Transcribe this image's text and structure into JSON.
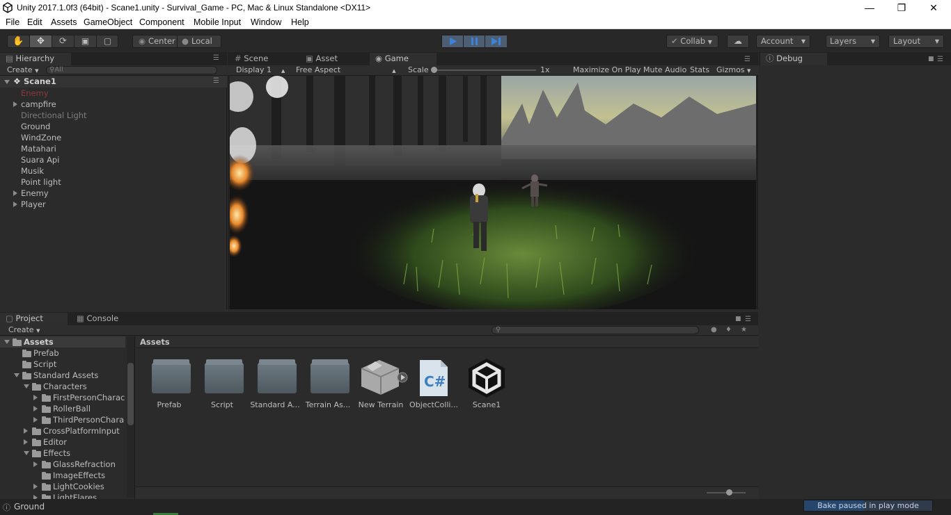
{
  "window": {
    "title": "Unity 2017.1.0f3 (64bit) - Scane1.unity - Survival_Game - PC, Mac & Linux Standalone <DX11>"
  },
  "menu": [
    "File",
    "Edit",
    "Assets",
    "GameObject",
    "Component",
    "Mobile Input",
    "Window",
    "Help"
  ],
  "toolbar": {
    "pivot": "Center",
    "space": "Local",
    "collab": "Collab",
    "account": "Account",
    "layers": "Layers",
    "layout": "Layout",
    "accent": "#3d82d6"
  },
  "hierarchy": {
    "tab": "Hierarchy",
    "create": "Create",
    "search_placeholder": "All",
    "scene": "Scane1",
    "items": [
      {
        "label": "Enemy",
        "expandable": false,
        "state": "missing"
      },
      {
        "label": "campfire",
        "expandable": true,
        "state": "normal"
      },
      {
        "label": "Directional Light",
        "expandable": false,
        "state": "disabled"
      },
      {
        "label": "Ground",
        "expandable": false,
        "state": "normal"
      },
      {
        "label": "WindZone",
        "expandable": false,
        "state": "normal"
      },
      {
        "label": "Matahari",
        "expandable": false,
        "state": "normal"
      },
      {
        "label": "Suara Api",
        "expandable": false,
        "state": "normal"
      },
      {
        "label": "Musik",
        "expandable": false,
        "state": "normal"
      },
      {
        "label": "Point light",
        "expandable": false,
        "state": "normal"
      },
      {
        "label": "Enemy",
        "expandable": true,
        "state": "normal"
      },
      {
        "label": "Player",
        "expandable": true,
        "state": "normal"
      }
    ]
  },
  "center_tabs": {
    "scene": "Scene",
    "asset_store": "Asset Store",
    "game": "Game"
  },
  "game_bar": {
    "display": "Display 1",
    "aspect": "Free Aspect",
    "scale_label": "Scale",
    "scale_value": "1x",
    "maximize": "Maximize On Play",
    "mute": "Mute Audio",
    "stats": "Stats",
    "gizmos": "Gizmos"
  },
  "debug": {
    "tab": "Debug"
  },
  "project": {
    "tab_project": "Project",
    "tab_console": "Console",
    "create": "Create",
    "breadcrumb": "Assets",
    "tree": [
      {
        "label": "Assets",
        "depth": 0,
        "arrow": "down",
        "bold": true
      },
      {
        "label": "Prefab",
        "depth": 1,
        "arrow": "none",
        "bold": false
      },
      {
        "label": "Script",
        "depth": 1,
        "arrow": "none",
        "bold": false
      },
      {
        "label": "Standard Assets",
        "depth": 1,
        "arrow": "down",
        "bold": false
      },
      {
        "label": "Characters",
        "depth": 2,
        "arrow": "down",
        "bold": false
      },
      {
        "label": "FirstPersonCharac",
        "depth": 3,
        "arrow": "right",
        "bold": false
      },
      {
        "label": "RollerBall",
        "depth": 3,
        "arrow": "right",
        "bold": false
      },
      {
        "label": "ThirdPersonChara",
        "depth": 3,
        "arrow": "right",
        "bold": false
      },
      {
        "label": "CrossPlatformInput",
        "depth": 2,
        "arrow": "right",
        "bold": false
      },
      {
        "label": "Editor",
        "depth": 2,
        "arrow": "right",
        "bold": false
      },
      {
        "label": "Effects",
        "depth": 2,
        "arrow": "down",
        "bold": false
      },
      {
        "label": "GlassRefraction",
        "depth": 3,
        "arrow": "right",
        "bold": false
      },
      {
        "label": "ImageEffects",
        "depth": 3,
        "arrow": "none",
        "bold": false
      },
      {
        "label": "LightCookies",
        "depth": 3,
        "arrow": "right",
        "bold": false
      },
      {
        "label": "LightFlares",
        "depth": 3,
        "arrow": "right",
        "bold": false
      }
    ],
    "assets": [
      {
        "label": "Prefab",
        "kind": "folder"
      },
      {
        "label": "Script",
        "kind": "folder"
      },
      {
        "label": "Standard A...",
        "kind": "folder"
      },
      {
        "label": "Terrain As...",
        "kind": "folder"
      },
      {
        "label": "New Terrain",
        "kind": "terrain"
      },
      {
        "label": "ObjectColli...",
        "kind": "script"
      },
      {
        "label": "Scane1",
        "kind": "scene"
      }
    ]
  },
  "status": {
    "selected": "Ground",
    "bake": "Bake paused in play mode"
  }
}
